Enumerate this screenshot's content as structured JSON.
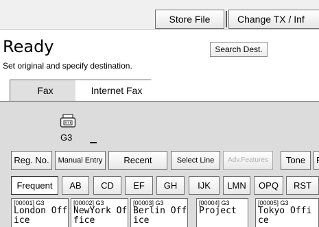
{
  "header": {
    "store_file": "Store File",
    "change_tx": "Change TX / Inf"
  },
  "status": {
    "title": "Ready",
    "instruction": "Set original and specify destination.",
    "search_dest": "Search Dest."
  },
  "tabs": {
    "fax": "Fax",
    "internet_fax": "Internet Fax"
  },
  "line": {
    "label": "G3"
  },
  "functions": {
    "reg_no": "Reg. No.",
    "manual_entry": "Manual Entry",
    "recent": "Recent",
    "select_line": "Select Line",
    "adv_features": "Adv.Features",
    "tone": "Tone",
    "next_partial": "P"
  },
  "groups": {
    "frequent": "Frequent",
    "ab": "AB",
    "cd": "CD",
    "ef": "EF",
    "gh": "GH",
    "ijk": "IJK",
    "lmn": "LMN",
    "opq": "OPQ",
    "rst": "RST"
  },
  "destinations": [
    {
      "code": "[00001] G3",
      "line1": "London Off",
      "line2": "ice"
    },
    {
      "code": "[00002] G3",
      "line1": "NewYork Of",
      "line2": "fice"
    },
    {
      "code": "[00003] G3",
      "line1": "Berlin Off",
      "line2": "ice"
    },
    {
      "code": "[00004] G3",
      "line1": "Project",
      "line2": ""
    },
    {
      "code": "[00005] G3",
      "line1": "Tokyo Offi",
      "line2": "ce"
    }
  ],
  "icons": {
    "fax_machine": "fax-machine-icon"
  }
}
